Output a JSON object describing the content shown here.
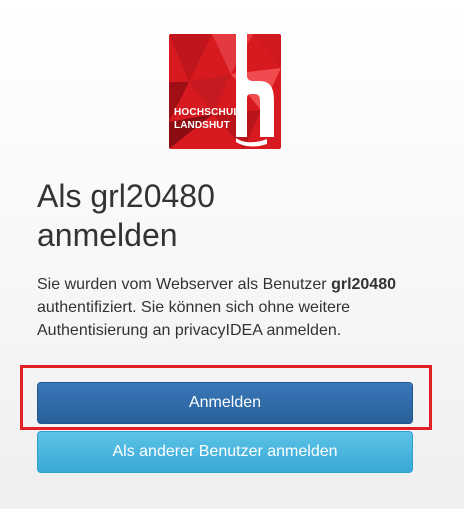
{
  "logo": {
    "line1": "HOCHSCHULE",
    "line2": "LANDSHUT",
    "background": "#d71a20"
  },
  "title": {
    "line1": "Als grl20480",
    "line2": "anmelden"
  },
  "message": {
    "prefix": "Sie wurden vom Webserver als Benutzer",
    "username": "grl20480",
    "suffix": "authentifiziert. Sie können sich ohne weitere Authentisierung an privacyIDEA anmelden."
  },
  "buttons": {
    "primary": "Anmelden",
    "secondary": "Als anderer Benutzer anmelden"
  },
  "colors": {
    "primary_button": "#2f6caa",
    "secondary_button": "#46b5df",
    "highlight": "#e31e24"
  }
}
